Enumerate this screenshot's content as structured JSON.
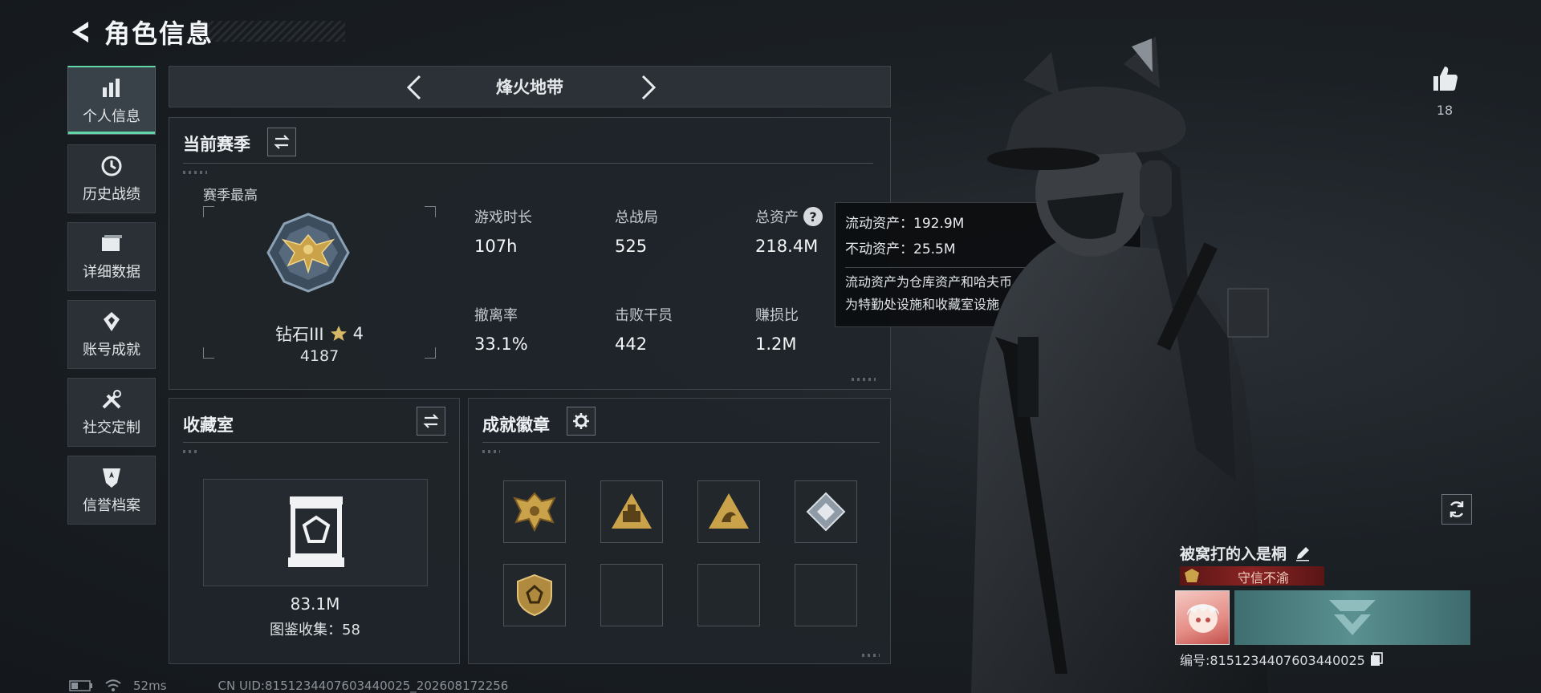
{
  "header": {
    "title": "角色信息"
  },
  "nav": [
    {
      "label": "个人信息",
      "icon": "bar-chart-icon",
      "active": true
    },
    {
      "label": "历史战绩",
      "icon": "history-icon"
    },
    {
      "label": "详细数据",
      "icon": "folder-icon"
    },
    {
      "label": "账号成就",
      "icon": "achievement-icon"
    },
    {
      "label": "社交定制",
      "icon": "tools-icon"
    },
    {
      "label": "信誉档案",
      "icon": "shield-icon"
    }
  ],
  "mode_selector": {
    "label": "烽火地带"
  },
  "season": {
    "title": "当前赛季",
    "best_label": "赛季最高",
    "rank_name": "钻石III",
    "rank_stars": "4",
    "rank_score": "4187",
    "stats": [
      {
        "label": "游戏时长",
        "value": "107h"
      },
      {
        "label": "总战局",
        "value": "525"
      },
      {
        "label": "总资产",
        "value": "218.4M"
      },
      {
        "label": "撤离率",
        "value": "33.1%"
      },
      {
        "label": "击败干员",
        "value": "442"
      },
      {
        "label": "赚损比",
        "value": "1.2M"
      }
    ]
  },
  "tooltip": {
    "liquid": "流动资产：192.9M",
    "fixed": "不动资产：25.5M",
    "desc_line1": "流动资产为仓库资产和哈夫币，不动资产",
    "desc_line2": "为特勤处设施和收藏室设施"
  },
  "collection": {
    "title": "收藏室",
    "value": "83.1M",
    "count": "图鉴收集：58"
  },
  "badges": {
    "title": "成就徽章"
  },
  "likes": {
    "count": "18"
  },
  "player": {
    "name": "被窝打的入是桐",
    "tag": "守信不渝",
    "id": "编号:8151234407603440025"
  },
  "status_bar": {
    "ping": "52ms",
    "uid": "CN UID:8151234407603440025_202608172256"
  },
  "colors": {
    "accent": "#63d6a8",
    "tag_red": "#7a1f1f",
    "gold": "#c9a24a"
  }
}
